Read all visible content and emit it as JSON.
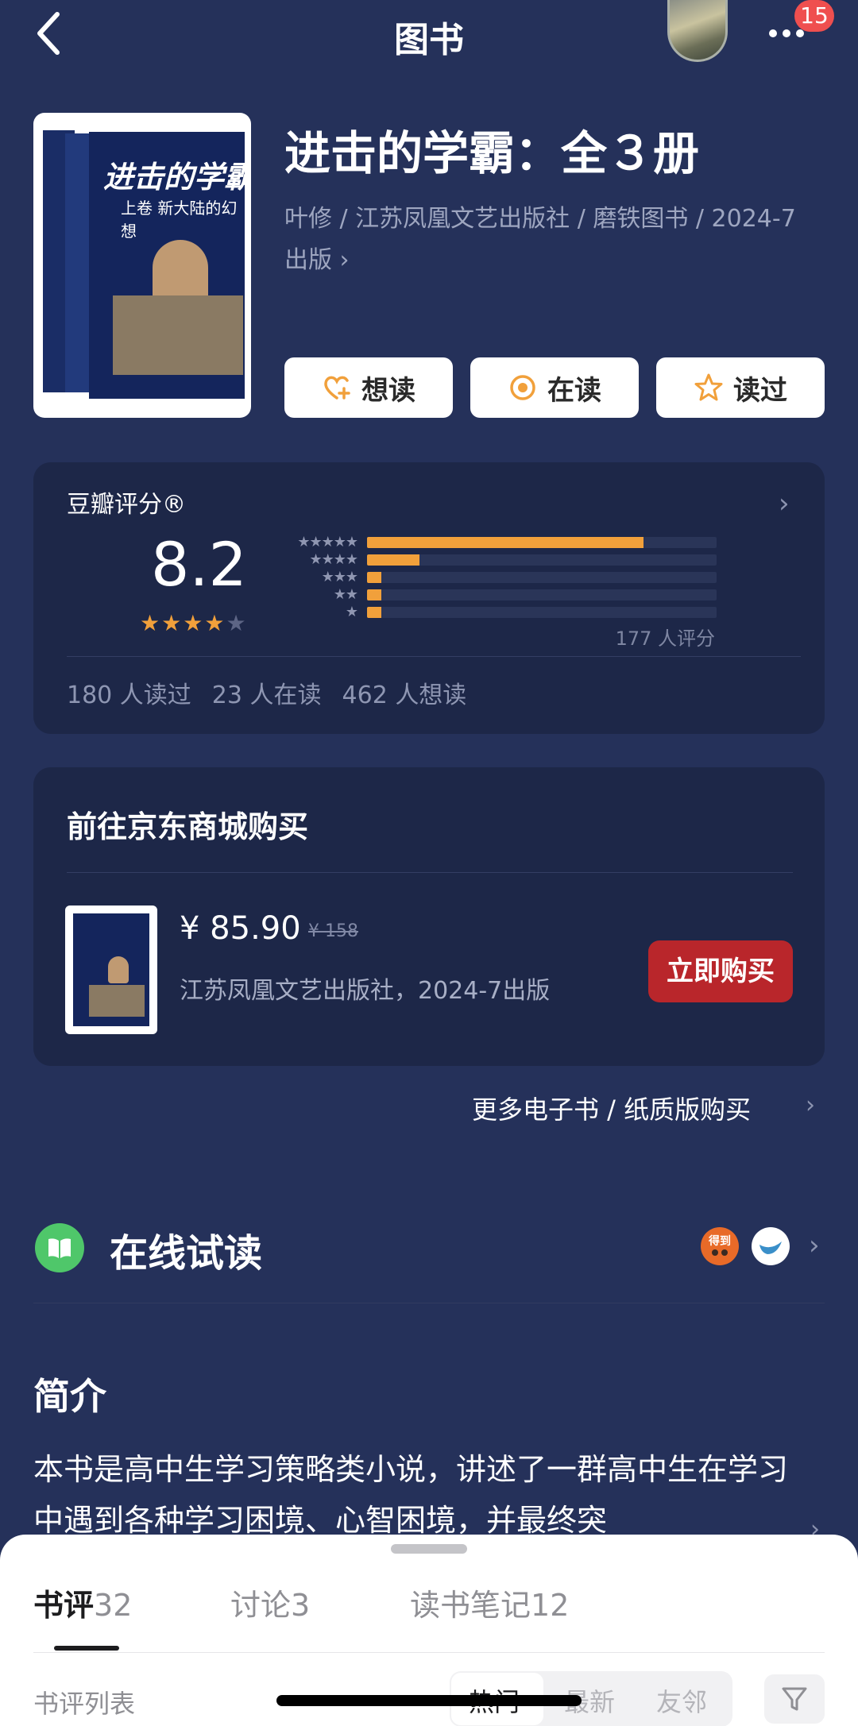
{
  "nav": {
    "title": "图书",
    "notification_count": "15"
  },
  "book": {
    "title": "进击的学霸：全３册",
    "meta": "叶修 / 江苏凤凰文艺出版社 / 磨铁图书 / 2024-7 出版",
    "cover_title": "进击的学霸",
    "cover_subtitle": "上卷 新大陆的幻想"
  },
  "actions": [
    {
      "label": "想读",
      "icon": "heart-plus-icon"
    },
    {
      "label": "在读",
      "icon": "target-icon"
    },
    {
      "label": "读过",
      "icon": "star-outline-icon"
    }
  ],
  "rating": {
    "label": "豆瓣评分®",
    "score": "8.2",
    "stars_filled": 4,
    "stars_total": 5,
    "distribution": [
      {
        "stars": "★★★★★",
        "fraction": 0.79
      },
      {
        "stars": "★★★★",
        "fraction": 0.15
      },
      {
        "stars": "★★★",
        "fraction": 0.04
      },
      {
        "stars": "★★",
        "fraction": 0.04
      },
      {
        "stars": "★",
        "fraction": 0.04
      }
    ],
    "count": "177 人评分",
    "read": "180 人读过",
    "reading": "23 人在读",
    "want": "462 人想读"
  },
  "buy": {
    "title": "前往京东商城购买",
    "price": "¥ 85.90",
    "original_price": "¥ 158",
    "publisher": "江苏凤凰文艺出版社，2024-7出版",
    "button": "立即购买",
    "more_link": "更多电子书 / 纸质版购买"
  },
  "online": {
    "title": "在线试读",
    "icon": "open-book-icon",
    "source1_label": "得到"
  },
  "intro": {
    "title": "简介",
    "text": "本书是高中生学习策略类小说，讲述了一群高中生在学习中遇到各种学习困境、心智困境，并最终突"
  },
  "sheet": {
    "tabs": [
      {
        "label": "书评",
        "count": "32"
      },
      {
        "label": "讨论",
        "count": "3"
      },
      {
        "label": "读书笔记",
        "count": "12"
      }
    ],
    "list_label": "书评列表",
    "sort_options": [
      "热门",
      "最新",
      "友邻"
    ]
  },
  "colors": {
    "background": "#25315a",
    "card": "#1d2748",
    "accent_orange": "#f1a03b",
    "buy_red": "#b9262b"
  }
}
